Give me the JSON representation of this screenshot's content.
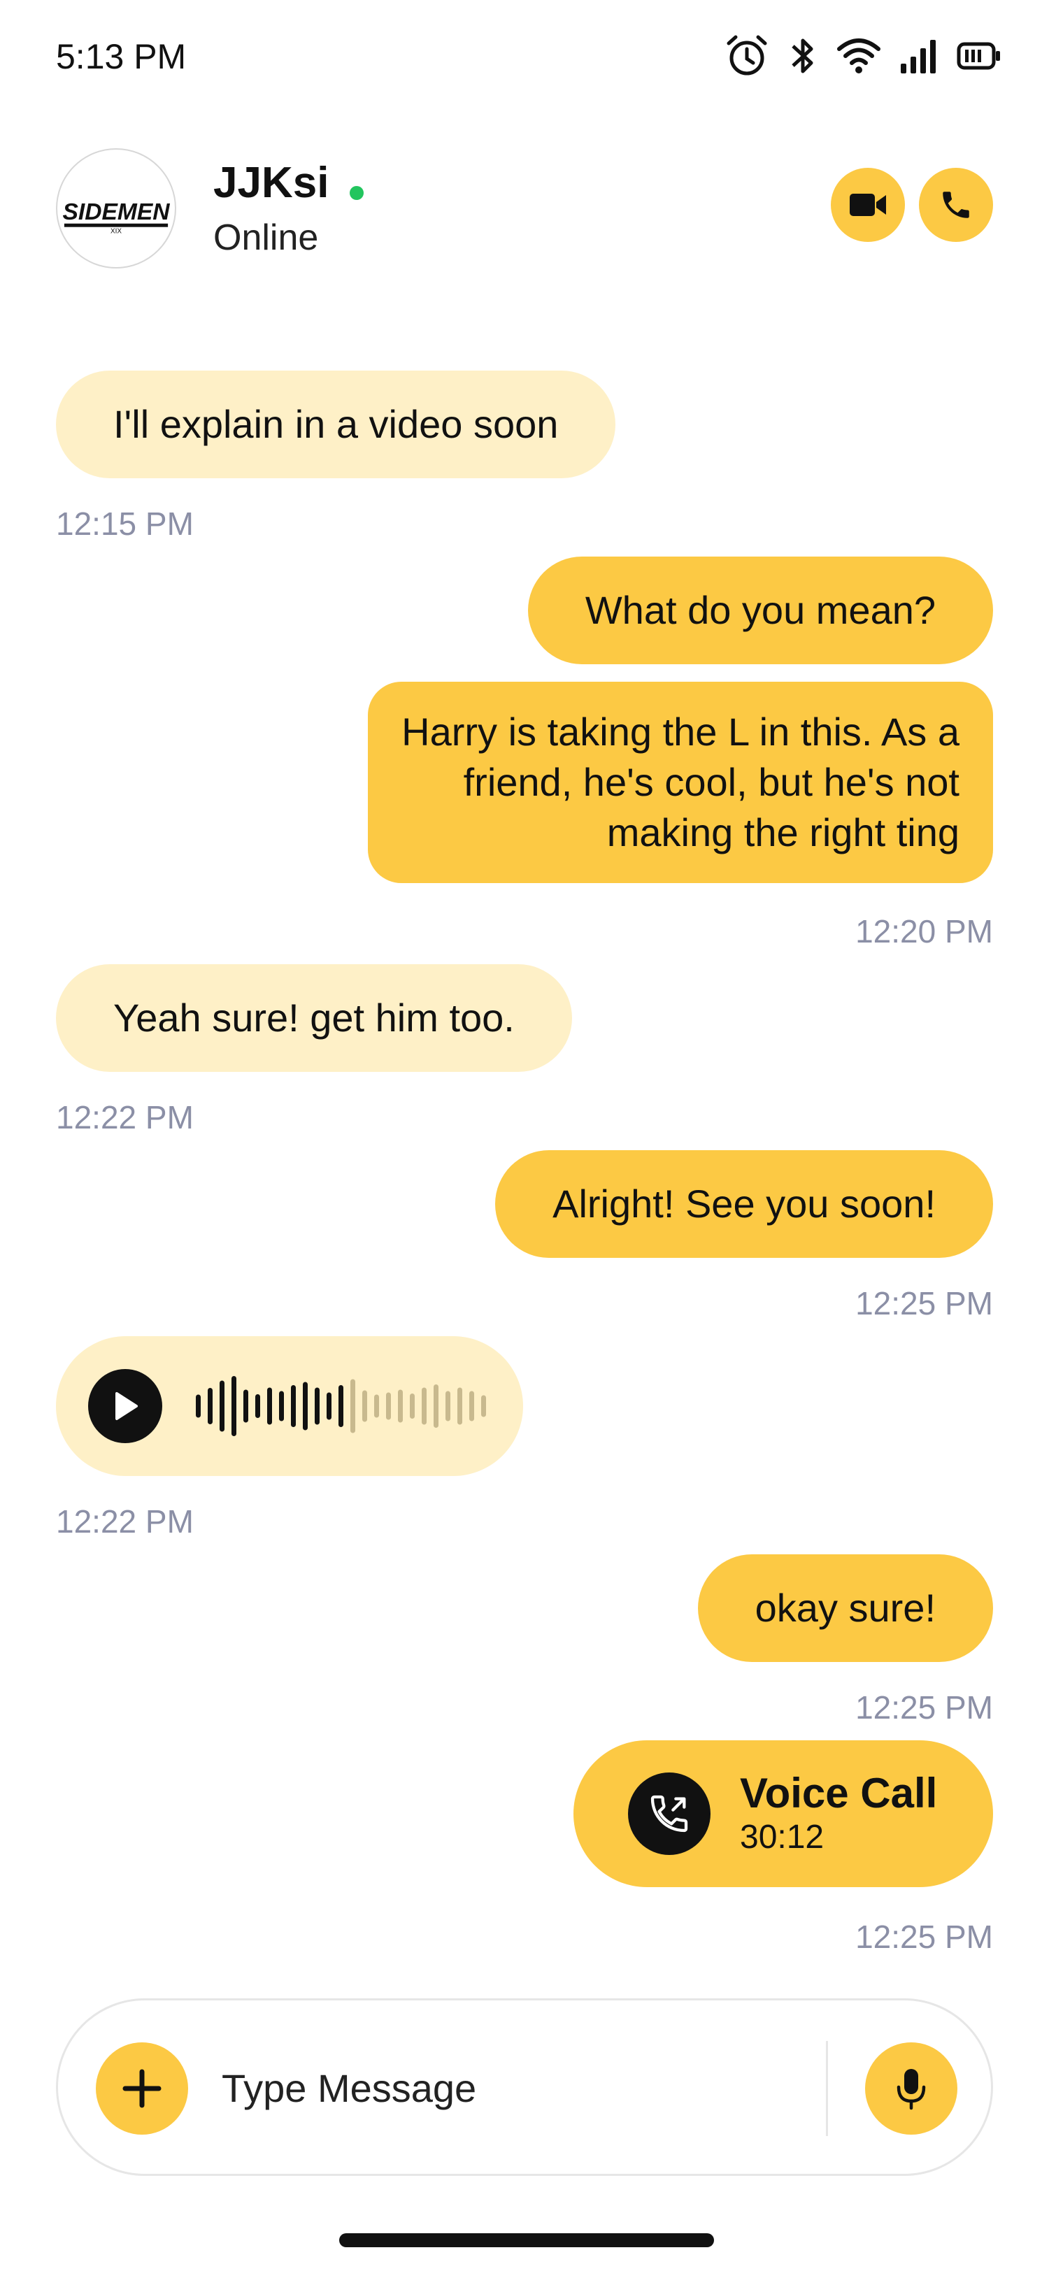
{
  "status_bar": {
    "time": "5:13 PM"
  },
  "contact": {
    "name": "JJKsi",
    "status": "Online",
    "avatar_text": "SIDEMEN",
    "avatar_sub": "XIX"
  },
  "messages": [
    {
      "dir": "in",
      "type": "text",
      "text": "I'll explain in a video soon",
      "time": "12:15 PM"
    },
    {
      "dir": "out",
      "type": "text",
      "text": "What do you mean?",
      "time": ""
    },
    {
      "dir": "out",
      "type": "text",
      "lines": [
        "Harry is taking the L in this. As a",
        "friend, he's cool, but he's not",
        "making the right ting"
      ],
      "time": "12:20 PM"
    },
    {
      "dir": "in",
      "type": "text",
      "text": "Yeah sure! get him too.",
      "time": "12:22 PM"
    },
    {
      "dir": "out",
      "type": "text",
      "text": "Alright! See you soon!",
      "time": "12:25 PM"
    },
    {
      "dir": "in",
      "type": "voice",
      "progress": 0.5,
      "time": "12:22 PM"
    },
    {
      "dir": "out",
      "type": "text",
      "text": "okay sure!",
      "time": "12:25 PM"
    },
    {
      "dir": "out",
      "type": "call",
      "title": "Voice Call",
      "duration": "30:12",
      "time": "12:25 PM"
    }
  ],
  "composer": {
    "placeholder": "Type Message"
  },
  "colors": {
    "accent": "#FCC944",
    "incoming": "#FEF0C7",
    "online": "#22c55e",
    "timestamp": "#8b8fa6"
  }
}
